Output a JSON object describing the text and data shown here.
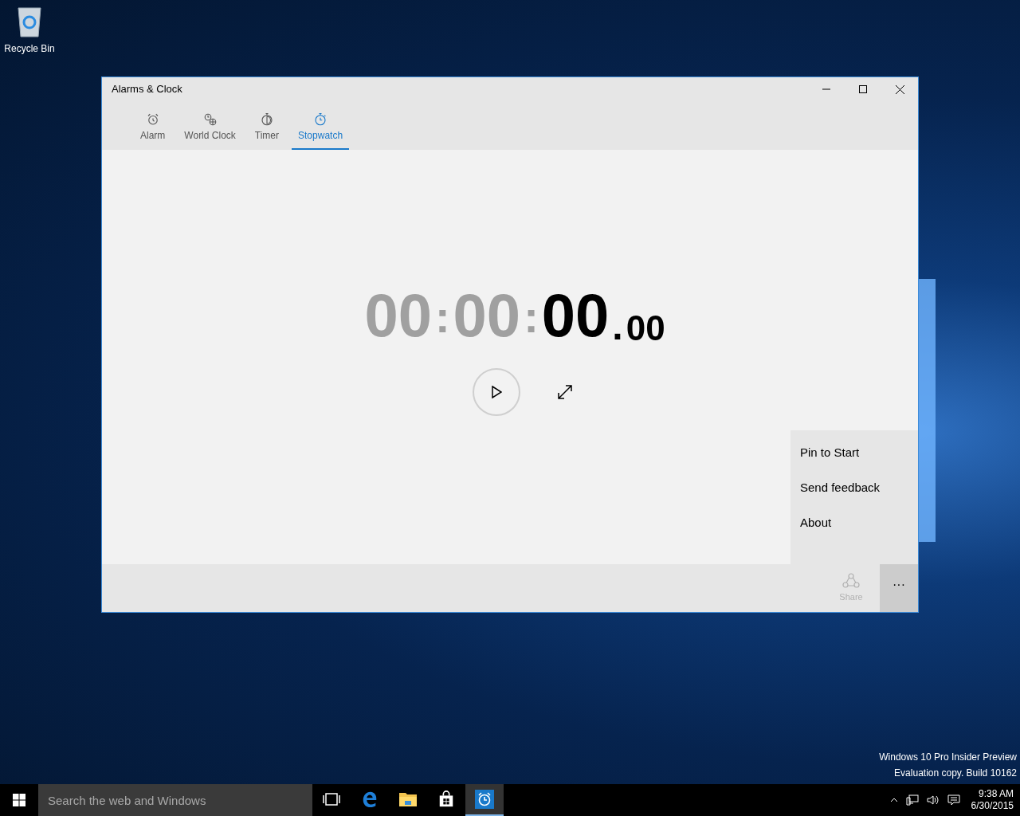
{
  "desktop_icons": [
    {
      "label": "Recycle Bin"
    }
  ],
  "window": {
    "title": "Alarms & Clock"
  },
  "tabs": [
    {
      "label": "Alarm",
      "kind": "alarm",
      "selected": false
    },
    {
      "label": "World Clock",
      "kind": "world",
      "selected": false
    },
    {
      "label": "Timer",
      "kind": "timer",
      "selected": false
    },
    {
      "label": "Stopwatch",
      "kind": "stopwatch",
      "selected": true
    }
  ],
  "stopwatch": {
    "segments": [
      {
        "text": "00",
        "kind": "dim"
      },
      {
        "text": ":",
        "kind": "colon"
      },
      {
        "text": "00",
        "kind": "dim"
      },
      {
        "text": ":",
        "kind": "colon"
      },
      {
        "text": "00",
        "kind": "main"
      },
      {
        "text": ".",
        "kind": "dot"
      },
      {
        "text": "00",
        "kind": "fraction"
      }
    ]
  },
  "more_menu": {
    "items": [
      "Pin to Start",
      "Send feedback",
      "About"
    ]
  },
  "app_bar": {
    "share": {
      "label": "Share",
      "disabled": true
    },
    "more": {
      "label": "···",
      "expanded": true
    }
  },
  "watermark_text": [
    "Windows 10 Pro Insider Preview",
    "Evaluation copy. Build 10162"
  ],
  "taskbar": {
    "search": {
      "placeholder": "Search the web and Windows"
    },
    "apps": [
      {
        "kind": "taskview",
        "active": false
      },
      {
        "kind": "edge",
        "active": false
      },
      {
        "kind": "explorer",
        "active": false
      },
      {
        "kind": "store",
        "active": false
      },
      {
        "kind": "clock",
        "active": true
      }
    ],
    "time": "9:38 AM",
    "date": "6/30/2015"
  }
}
